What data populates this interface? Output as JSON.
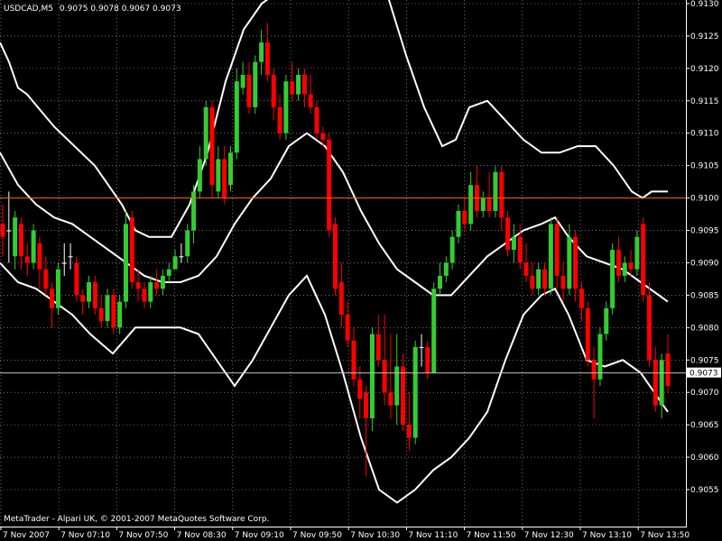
{
  "header": {
    "symbol_timeframe": "USDCAD,M5",
    "ohlc": "0.9075 0.9078 0.9067 0.9073"
  },
  "footer": {
    "copyright": "MetaTrader - Alpari UK, © 2001-2007 MetaQuotes Software Corp."
  },
  "colors": {
    "background": "#000000",
    "grid": "#ffffff",
    "bull_candle": "#32cd32",
    "bear_candle": "#ff0000",
    "doji_candle": "#ffffff",
    "bands": "#ffffff",
    "level_line": "#ff6600",
    "bid_line": "#c0c0c0"
  },
  "chart_data": {
    "type": "candlestick",
    "instrument": "USDCAD",
    "timeframe": "M5",
    "ylim": [
      0.90505,
      0.913
    ],
    "y_ticks": [
      "0.9130",
      "0.9125",
      "0.9120",
      "0.9115",
      "0.9110",
      "0.9105",
      "0.9100",
      "0.9095",
      "0.9090",
      "0.9085",
      "0.9080",
      "0.9075",
      "0.9070",
      "0.9065",
      "0.9060",
      "0.9055"
    ],
    "x_tick_labels": [
      "7 Nov 2007",
      "7 Nov 07:10",
      "7 Nov 07:50",
      "7 Nov 08:30",
      "7 Nov 09:10",
      "7 Nov 09:50",
      "7 Nov 10:30",
      "7 Nov 11:10",
      "7 Nov 11:50",
      "7 Nov 12:30",
      "7 Nov 13:10",
      "7 Nov 13:50"
    ],
    "grid": true,
    "horizontal_level": 0.91,
    "current_price": "0.9073",
    "candles": [
      [
        0.9096,
        0.9094,
        0.9099,
        0.9091
      ],
      [
        0.9095,
        0.9095,
        0.9101,
        0.909
      ],
      [
        0.9091,
        0.9097,
        0.9098,
        0.9089
      ],
      [
        0.9096,
        0.9091,
        0.9097,
        0.9089
      ],
      [
        0.9091,
        0.909,
        0.9093,
        0.9088
      ],
      [
        0.909,
        0.9095,
        0.9096,
        0.9089
      ],
      [
        0.9093,
        0.9089,
        0.9094,
        0.9086
      ],
      [
        0.9089,
        0.9086,
        0.9091,
        0.9085
      ],
      [
        0.9086,
        0.9083,
        0.9087,
        0.908
      ],
      [
        0.9083,
        0.9089,
        0.909,
        0.9082
      ],
      [
        0.909,
        0.909,
        0.9093,
        0.9088
      ],
      [
        0.9091,
        0.9091,
        0.9093,
        0.9089
      ],
      [
        0.909,
        0.9085,
        0.9091,
        0.9084
      ],
      [
        0.9085,
        0.9084,
        0.9086,
        0.9082
      ],
      [
        0.9084,
        0.9087,
        0.9088,
        0.9083
      ],
      [
        0.9087,
        0.9083,
        0.9088,
        0.9082
      ],
      [
        0.9083,
        0.9081,
        0.9085,
        0.908
      ],
      [
        0.9081,
        0.9085,
        0.9086,
        0.908
      ],
      [
        0.9085,
        0.908,
        0.9086,
        0.9079
      ],
      [
        0.908,
        0.9084,
        0.9085,
        0.9079
      ],
      [
        0.9084,
        0.9096,
        0.9098,
        0.9083
      ],
      [
        0.9097,
        0.9087,
        0.9098,
        0.9086
      ],
      [
        0.9087,
        0.9086,
        0.9089,
        0.9084
      ],
      [
        0.9086,
        0.9084,
        0.9087,
        0.9083
      ],
      [
        0.9084,
        0.9087,
        0.9088,
        0.9083
      ],
      [
        0.9087,
        0.9086,
        0.9089,
        0.9085
      ],
      [
        0.9086,
        0.9088,
        0.9089,
        0.9085
      ],
      [
        0.9088,
        0.9089,
        0.909,
        0.9087
      ],
      [
        0.9089,
        0.9091,
        0.9092,
        0.9089
      ],
      [
        0.9091,
        0.9091,
        0.9093,
        0.909
      ],
      [
        0.9091,
        0.9095,
        0.9096,
        0.909
      ],
      [
        0.9095,
        0.9101,
        0.9102,
        0.9093
      ],
      [
        0.9101,
        0.9106,
        0.9108,
        0.91
      ],
      [
        0.9106,
        0.9114,
        0.9115,
        0.9105
      ],
      [
        0.9114,
        0.9102,
        0.9115,
        0.91
      ],
      [
        0.9101,
        0.9106,
        0.9108,
        0.91
      ],
      [
        0.9106,
        0.91,
        0.9108,
        0.9099
      ],
      [
        0.9102,
        0.9107,
        0.9108,
        0.9101
      ],
      [
        0.9107,
        0.9118,
        0.912,
        0.9106
      ],
      [
        0.9117,
        0.9119,
        0.9121,
        0.9116
      ],
      [
        0.9119,
        0.9114,
        0.9121,
        0.9113
      ],
      [
        0.9114,
        0.9121,
        0.9122,
        0.9113
      ],
      [
        0.9121,
        0.9124,
        0.9126,
        0.9119
      ],
      [
        0.9124,
        0.9119,
        0.9127,
        0.9118
      ],
      [
        0.9119,
        0.9114,
        0.912,
        0.9112
      ],
      [
        0.9114,
        0.911,
        0.9116,
        0.9109
      ],
      [
        0.911,
        0.9118,
        0.9119,
        0.9109
      ],
      [
        0.9118,
        0.9116,
        0.9121,
        0.9115
      ],
      [
        0.9116,
        0.9119,
        0.912,
        0.9115
      ],
      [
        0.9119,
        0.9116,
        0.912,
        0.9114
      ],
      [
        0.9116,
        0.9114,
        0.9119,
        0.9113
      ],
      [
        0.9114,
        0.911,
        0.9115,
        0.9109
      ],
      [
        0.911,
        0.9109,
        0.9111,
        0.9108
      ],
      [
        0.9109,
        0.9095,
        0.911,
        0.9094
      ],
      [
        0.9096,
        0.9086,
        0.9097,
        0.9085
      ],
      [
        0.9087,
        0.9082,
        0.909,
        0.908
      ],
      [
        0.9082,
        0.9078,
        0.9084,
        0.9077
      ],
      [
        0.9078,
        0.9072,
        0.908,
        0.9071
      ],
      [
        0.9072,
        0.9069,
        0.9074,
        0.9066
      ],
      [
        0.907,
        0.9066,
        0.9071,
        0.9057
      ],
      [
        0.9066,
        0.9079,
        0.908,
        0.9064
      ],
      [
        0.9079,
        0.9075,
        0.9082,
        0.9074
      ],
      [
        0.9075,
        0.907,
        0.9082,
        0.9068
      ],
      [
        0.907,
        0.9068,
        0.9079,
        0.9066
      ],
      [
        0.9068,
        0.9074,
        0.9079,
        0.9065
      ],
      [
        0.9074,
        0.9065,
        0.9076,
        0.9064
      ],
      [
        0.9065,
        0.9063,
        0.907,
        0.9061
      ],
      [
        0.9063,
        0.9077,
        0.9078,
        0.9062
      ],
      [
        0.9077,
        0.9077,
        0.9079,
        0.9074
      ],
      [
        0.9077,
        0.9073,
        0.9078,
        0.9072
      ],
      [
        0.9073,
        0.9086,
        0.9087,
        0.9073
      ],
      [
        0.9086,
        0.9088,
        0.909,
        0.9085
      ],
      [
        0.9088,
        0.909,
        0.9091,
        0.9087
      ],
      [
        0.909,
        0.9094,
        0.9095,
        0.9089
      ],
      [
        0.9094,
        0.9098,
        0.9099,
        0.9093
      ],
      [
        0.9098,
        0.9096,
        0.91,
        0.9095
      ],
      [
        0.9096,
        0.9102,
        0.9104,
        0.9095
      ],
      [
        0.9102,
        0.9098,
        0.9105,
        0.9097
      ],
      [
        0.9098,
        0.91,
        0.9101,
        0.9097
      ],
      [
        0.91,
        0.9098,
        0.9104,
        0.9097
      ],
      [
        0.9098,
        0.9104,
        0.9105,
        0.9097
      ],
      [
        0.9104,
        0.9097,
        0.9105,
        0.9095
      ],
      [
        0.9097,
        0.9092,
        0.9098,
        0.9091
      ],
      [
        0.9092,
        0.9094,
        0.9096,
        0.909
      ],
      [
        0.9094,
        0.909,
        0.9096,
        0.9089
      ],
      [
        0.909,
        0.9088,
        0.9093,
        0.9087
      ],
      [
        0.9088,
        0.9086,
        0.909,
        0.9085
      ],
      [
        0.9086,
        0.9089,
        0.909,
        0.9085
      ],
      [
        0.9089,
        0.9086,
        0.909,
        0.9085
      ],
      [
        0.9086,
        0.9096,
        0.9097,
        0.9085
      ],
      [
        0.9096,
        0.9088,
        0.9097,
        0.9086
      ],
      [
        0.9088,
        0.9086,
        0.909,
        0.9084
      ],
      [
        0.9086,
        0.9094,
        0.9096,
        0.9085
      ],
      [
        0.9094,
        0.9086,
        0.9095,
        0.9084
      ],
      [
        0.9086,
        0.9083,
        0.9087,
        0.9081
      ],
      [
        0.9083,
        0.9075,
        0.9084,
        0.9074
      ],
      [
        0.9075,
        0.9072,
        0.9077,
        0.9066
      ],
      [
        0.9072,
        0.9079,
        0.908,
        0.9071
      ],
      [
        0.9079,
        0.9083,
        0.9084,
        0.9078
      ],
      [
        0.9083,
        0.9092,
        0.9093,
        0.9082
      ],
      [
        0.9092,
        0.9088,
        0.9094,
        0.9087
      ],
      [
        0.9088,
        0.909,
        0.9091,
        0.9087
      ],
      [
        0.909,
        0.9089,
        0.9092,
        0.9088
      ],
      [
        0.9089,
        0.9094,
        0.9095,
        0.9088
      ],
      [
        0.9096,
        0.9085,
        0.9097,
        0.9084
      ],
      [
        0.9085,
        0.9075,
        0.9087,
        0.9074
      ],
      [
        0.9075,
        0.9068,
        0.9077,
        0.9067
      ],
      [
        0.9068,
        0.9075,
        0.9076,
        0.9066
      ],
      [
        0.9076,
        0.9071,
        0.9079,
        0.907
      ]
    ],
    "bands": {
      "upper": [
        [
          0,
          0.9124
        ],
        [
          10,
          0.9121
        ],
        [
          20,
          0.9117
        ],
        [
          30,
          0.9116
        ],
        [
          42,
          0.9114
        ],
        [
          60,
          0.9111
        ],
        [
          75,
          0.9109
        ],
        [
          90,
          0.9107
        ],
        [
          105,
          0.9105
        ],
        [
          120,
          0.9102
        ],
        [
          135,
          0.9099
        ],
        [
          150,
          0.9095
        ],
        [
          165,
          0.9094
        ],
        [
          190,
          0.9094
        ],
        [
          210,
          0.9099
        ],
        [
          230,
          0.9107
        ],
        [
          250,
          0.9118
        ],
        [
          270,
          0.9126
        ],
        [
          290,
          0.913
        ],
        [
          320,
          0.9133
        ],
        [
          360,
          0.9136
        ],
        [
          400,
          0.9136
        ],
        [
          430,
          0.9131
        ],
        [
          450,
          0.9122
        ],
        [
          470,
          0.9114
        ],
        [
          490,
          0.9108
        ],
        [
          505,
          0.9109
        ],
        [
          520,
          0.9114
        ],
        [
          540,
          0.9115
        ],
        [
          560,
          0.9112
        ],
        [
          580,
          0.9109
        ],
        [
          600,
          0.9107
        ],
        [
          620,
          0.9107
        ],
        [
          640,
          0.9108
        ],
        [
          660,
          0.9108
        ],
        [
          680,
          0.9105
        ],
        [
          700,
          0.9101
        ],
        [
          712,
          0.91
        ],
        [
          722,
          0.9101
        ],
        [
          740,
          0.9101
        ]
      ],
      "middle": [
        [
          0,
          0.9107
        ],
        [
          20,
          0.9102
        ],
        [
          40,
          0.9099
        ],
        [
          60,
          0.9097
        ],
        [
          80,
          0.9096
        ],
        [
          100,
          0.9094
        ],
        [
          120,
          0.9092
        ],
        [
          140,
          0.909
        ],
        [
          160,
          0.9088
        ],
        [
          180,
          0.9087
        ],
        [
          200,
          0.9087
        ],
        [
          220,
          0.9088
        ],
        [
          240,
          0.9091
        ],
        [
          260,
          0.9096
        ],
        [
          280,
          0.91
        ],
        [
          300,
          0.9103
        ],
        [
          320,
          0.9108
        ],
        [
          340,
          0.911
        ],
        [
          360,
          0.9108
        ],
        [
          380,
          0.9104
        ],
        [
          400,
          0.9098
        ],
        [
          420,
          0.9093
        ],
        [
          440,
          0.9089
        ],
        [
          460,
          0.9087
        ],
        [
          480,
          0.9085
        ],
        [
          500,
          0.9085
        ],
        [
          520,
          0.9088
        ],
        [
          540,
          0.9091
        ],
        [
          560,
          0.9093
        ],
        [
          580,
          0.9095
        ],
        [
          600,
          0.9096
        ],
        [
          615,
          0.9097
        ],
        [
          630,
          0.9094
        ],
        [
          650,
          0.9091
        ],
        [
          670,
          0.909
        ],
        [
          690,
          0.9089
        ],
        [
          710,
          0.9087
        ],
        [
          740,
          0.9084
        ]
      ],
      "lower": [
        [
          0,
          0.909
        ],
        [
          20,
          0.9087
        ],
        [
          40,
          0.9086
        ],
        [
          60,
          0.9084
        ],
        [
          80,
          0.9082
        ],
        [
          100,
          0.9079
        ],
        [
          125,
          0.9076
        ],
        [
          150,
          0.908
        ],
        [
          170,
          0.908
        ],
        [
          200,
          0.908
        ],
        [
          220,
          0.9079
        ],
        [
          240,
          0.9075
        ],
        [
          260,
          0.9071
        ],
        [
          280,
          0.9075
        ],
        [
          300,
          0.908
        ],
        [
          320,
          0.9085
        ],
        [
          340,
          0.9088
        ],
        [
          360,
          0.9082
        ],
        [
          380,
          0.9073
        ],
        [
          400,
          0.9063
        ],
        [
          420,
          0.9055
        ],
        [
          440,
          0.9053
        ],
        [
          460,
          0.9055
        ],
        [
          480,
          0.9058
        ],
        [
          500,
          0.906
        ],
        [
          520,
          0.9063
        ],
        [
          540,
          0.9067
        ],
        [
          560,
          0.9075
        ],
        [
          580,
          0.9082
        ],
        [
          600,
          0.9085
        ],
        [
          615,
          0.9086
        ],
        [
          630,
          0.9082
        ],
        [
          650,
          0.9075
        ],
        [
          670,
          0.9074
        ],
        [
          690,
          0.9075
        ],
        [
          710,
          0.9073
        ],
        [
          740,
          0.9067
        ]
      ]
    }
  }
}
